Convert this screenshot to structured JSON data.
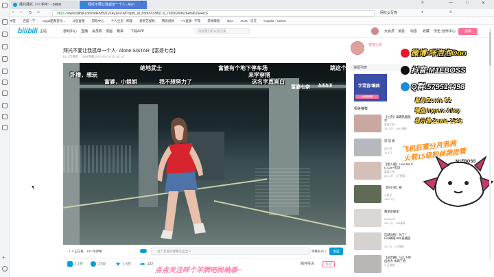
{
  "browser": {
    "tabs": [
      {
        "label": "拜托拜托（ᵒ̤̑ ᵒ̤̑ 手杯~ - bilibili"
      },
      {
        "label": "拜托不要让我孤单一个人- Alon"
      }
    ],
    "url_scheme": "https://",
    "url_rest": "www.bilibili.com/video/BV1vZ4y1w7uW?spm_id_from=333851.b_72656269626469616e4d.6",
    "bookmarks": [
      "书签",
      "百度一下",
      "cogoli酷我音乐...",
      "斗鱼直播",
      "游戏中心",
      "个人主页 - 哔哩",
      "爱奇艺视频",
      "腾讯视频",
      "YY直播 - 不夜",
      "游戏赚钱",
      "iDao",
      "JUJX - 天天",
      "Cogolia - CSGO"
    ],
    "search_engine": "网红女写真"
  },
  "site": {
    "logo": "bilibili",
    "nav": [
      "主站",
      "游戏中心",
      "直播",
      "会员购",
      "漫画",
      "赛事"
    ],
    "download": "下载APP",
    "search_placeholder": "你好我们的以前写真",
    "user_nav": [
      "大会员",
      "消息",
      "动态",
      "收藏",
      "历史",
      "创作中心"
    ],
    "upload": "投稿"
  },
  "video": {
    "title": "拜托不要让我孤单一个人- Alone.SISTAR【富婆七奈】",
    "meta": "61.4万播放 · 1568弹幕 2021-02-19 15:36:14",
    "viewers": "1 人正在看，152 条弹幕",
    "danmu_placeholder": "发个友善的弹幕见证当下",
    "danmu_etiquette": "弹幕礼仪 >",
    "send": "发送",
    "actions": {
      "like": "1.1万",
      "coin": "2732",
      "fav": "1.5万",
      "share": "432"
    },
    "report": "稿件投诉",
    "notes": "笔记",
    "watermark": "富婆七奈",
    "bili_wm": "bilibili"
  },
  "danmaku": [
    {
      "text": "绝地武士"
    },
    {
      "text": "富婆有个地下停车场"
    },
    {
      "text": "跳这个"
    },
    {
      "text": "卧槽，想玩"
    },
    {
      "text": "来学穿搭"
    },
    {
      "text": "富婆，小姐姐"
    },
    {
      "text": "我不想努力了"
    },
    {
      "text": "这名字真直白"
    }
  ],
  "sidebar": {
    "up_name": "富婆七奈",
    "charge": "充电",
    "follow": "关注",
    "danmu_list": "弹幕列表",
    "promo_title": "字混音/编曲",
    "promo_btn": "为你推荐购",
    "related_head": "相关推荐",
    "recs": [
      {
        "title": "【七奈】高跟乳酸放水",
        "up": "富婆七奈",
        "stat": "131.5万 · 1597弹幕",
        "color": "#caa8a0"
      },
      {
        "title": "深 双 爽",
        "up": "幼小的",
        "stat": "34.4万",
        "color": "#b5b8bd"
      },
      {
        "title": "【相入版】Love Me If U Can~乱风",
        "up": "富婆七奈",
        "stat": "657.6万 · 1万弹幕",
        "color": "#d5c0b8"
      },
      {
        "title": "【四小坐】桃",
        "up": "小鸥子",
        "stat": "1860.3万",
        "color": "#5f6b55"
      },
      {
        "title": "哪里是哪里",
        "up": "KIKKIO27",
        "stat": "225.4万 · 108弹幕",
        "color": "#dcd7d3"
      },
      {
        "title": "这就对啦！对了！Lisa舞蹈 50K直播回",
        "up": "",
        "stat": "45.7万 · 213弹幕",
        "color": "#d8d2cf"
      },
      {
        "title": "【这世舞】马儿下地出水大 水滴了哈",
        "up": "小丑很难",
        "stat": "",
        "color": "#b9b6b3"
      }
    ]
  },
  "overlay": {
    "weibo": "微博:咩泡泡Ooo",
    "douyin": "抖音:M1EBOSS",
    "qq": "Q群:579514498",
    "gear1": "鼠标:Zowie S2",
    "gear2": "键盘:hyperx Alloy",
    "gear3": "显示器:Zowie 2546",
    "mp1": "飞机狂蜜分月男两",
    "mp2": "火箭15级粉丝牌房管",
    "mascot_label": "M1EBOSS",
    "banner": "点点关注咩个羊牌吧民纳泰~"
  }
}
